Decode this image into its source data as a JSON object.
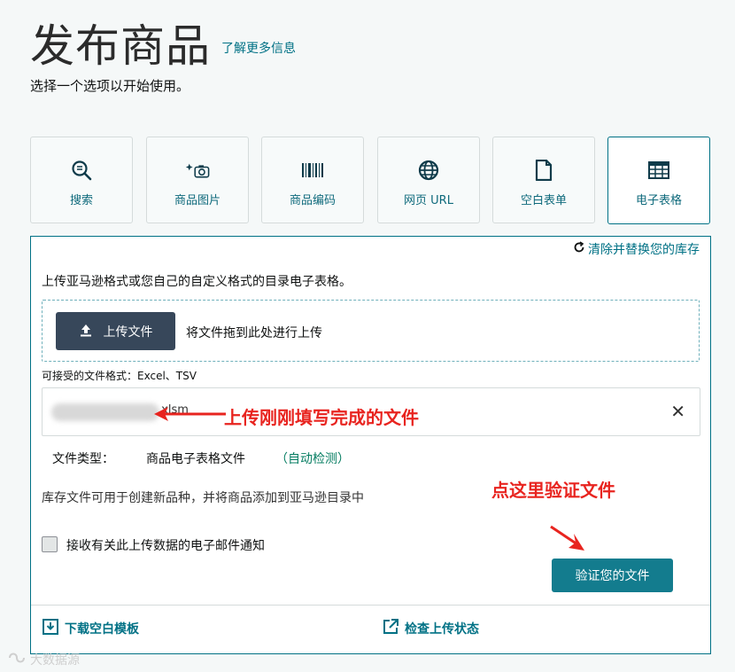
{
  "header": {
    "title": "发布商品",
    "learn_more": "了解更多信息",
    "subtitle": "选择一个选项以开始使用。"
  },
  "tiles": [
    {
      "label": "搜索",
      "icon": "search-icon"
    },
    {
      "label": "商品图片",
      "icon": "camera-icon"
    },
    {
      "label": "商品编码",
      "icon": "barcode-icon"
    },
    {
      "label": "网页 URL",
      "icon": "globe-icon"
    },
    {
      "label": "空白表单",
      "icon": "document-icon"
    },
    {
      "label": "电子表格",
      "icon": "spreadsheet-icon",
      "selected": true
    }
  ],
  "panel": {
    "clear_link": "清除并替换您的库存",
    "description": "上传亚马逊格式或您自己的自定义格式的目录电子表格。",
    "upload_button": "上传文件",
    "drop_text": "将文件拖到此处进行上传",
    "accepted_formats": "可接受的文件格式：Excel、TSV",
    "file_name_suffix": ".xlsm",
    "file_type_label": "文件类型：",
    "file_type_value": "商品电子表格文件",
    "file_type_auto": "（自动检测）",
    "inventory_note": "库存文件可用于创建新品种，并将商品添加到亚马逊目录中",
    "email_checkbox_label": "接收有关此上传数据的电子邮件通知",
    "verify_button": "验证您的文件",
    "download_template": "下载空白模板",
    "check_status": "检查上传状态"
  },
  "annotations": {
    "upload_hint": "上传刚刚填写完成的文件",
    "verify_hint": "点这里验证文件"
  },
  "watermark": "大数据源",
  "colors": {
    "accent": "#007185",
    "dark_button": "#37475a",
    "primary_button": "#137c8e",
    "annotation": "#e8241f"
  }
}
